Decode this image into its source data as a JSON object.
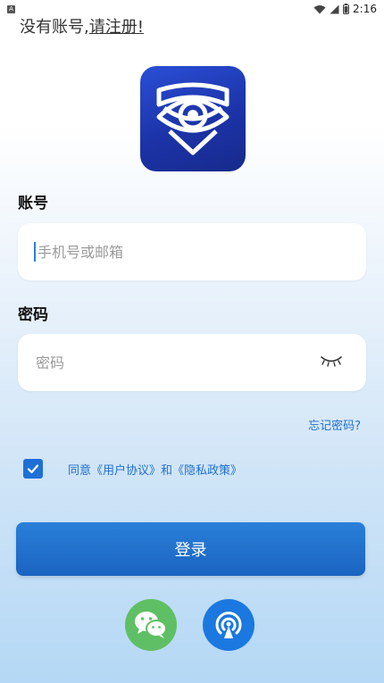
{
  "status_bar": {
    "notification_badge": "A",
    "time": "2:16"
  },
  "register": {
    "prompt": "没有账号,",
    "link": "请注册!"
  },
  "account": {
    "label": "账号",
    "placeholder": "手机号或邮箱",
    "value": ""
  },
  "password": {
    "label": "密码",
    "placeholder": "密码",
    "value": ""
  },
  "forgot_label": "忘记密码?",
  "agreement": {
    "checked": true,
    "prefix": "同意",
    "user_agreement": "《用户协议》",
    "conjunction": "和",
    "privacy_policy": "《隐私政策》"
  },
  "login_label": "登录",
  "social_login": [
    "wechat-icon",
    "signal-icon"
  ],
  "colors": {
    "primary": "#1E6FD6",
    "link": "#1F6FD0",
    "wechat": "#5FBF65"
  }
}
